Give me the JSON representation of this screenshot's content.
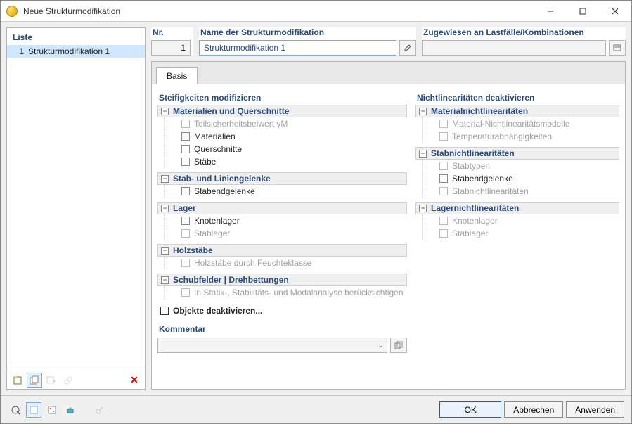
{
  "window": {
    "title": "Neue Strukturmodifikation"
  },
  "liste": {
    "header": "Liste",
    "items": [
      {
        "index": "1",
        "label": "Strukturmodifikation 1"
      }
    ]
  },
  "nr": {
    "label": "Nr.",
    "value": "1"
  },
  "name": {
    "label": "Name der Strukturmodifikation",
    "value": "Strukturmodifikation 1"
  },
  "assigned": {
    "label": "Zugewiesen an Lastfälle/Kombinationen",
    "value": ""
  },
  "tabs": {
    "basis": "Basis"
  },
  "left_col_title": "Steifigkeiten modifizieren",
  "right_col_title": "Nichtlinearitäten deaktivieren",
  "groups": {
    "materialien": {
      "title": "Materialien und Querschnitte",
      "items": {
        "teilsicherheit": "Teilsicherheitsbeiwert γM",
        "materialien": "Materialien",
        "querschnitte": "Querschnitte",
        "staebe": "Stäbe"
      }
    },
    "gelenke": {
      "title": "Stab- und Liniengelenke",
      "items": {
        "stabendgelenke": "Stabendgelenke"
      }
    },
    "lager": {
      "title": "Lager",
      "items": {
        "knotenlager": "Knotenlager",
        "stablager": "Stablager"
      }
    },
    "holz": {
      "title": "Holzstäbe",
      "items": {
        "feuchte": "Holzstäbe durch Feuchteklasse"
      }
    },
    "schub": {
      "title": "Schubfelder | Drehbettungen",
      "items": {
        "analyse": "In Statik-, Stabilitäts- und Modalanalyse berücksichtigen"
      }
    },
    "matnl": {
      "title": "Materialnichtlinearitäten",
      "items": {
        "modelle": "Material-Nichtlinearitätsmodelle",
        "temp": "Temperaturabhängigkeiten"
      }
    },
    "stabnl": {
      "title": "Stabnichtlinearitäten",
      "items": {
        "stabtypen": "Stabtypen",
        "stabendgelenke": "Stabendgelenke",
        "stabnl": "Stabnichtlinearitäten"
      }
    },
    "lagernl": {
      "title": "Lagernichtlinearitäten",
      "items": {
        "knotenlager": "Knotenlager",
        "stablager": "Stablager"
      }
    }
  },
  "deaktivieren": "Objekte deaktivieren...",
  "kommentar": {
    "label": "Kommentar",
    "value": ""
  },
  "buttons": {
    "ok": "OK",
    "cancel": "Abbrechen",
    "apply": "Anwenden"
  }
}
